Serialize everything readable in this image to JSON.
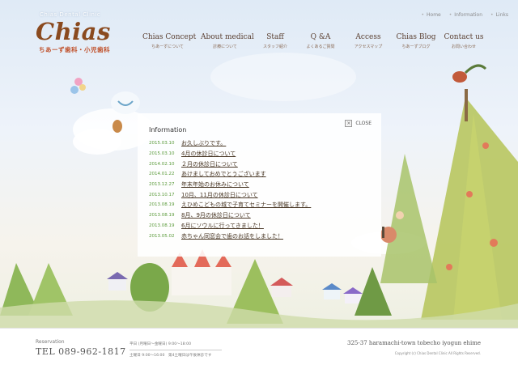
{
  "logo": {
    "small": "Chias Dental Clinic",
    "main": "Chias",
    "sub": "ちあーず歯科・小児歯科"
  },
  "top_links": [
    {
      "label": "Home"
    },
    {
      "label": "Information"
    },
    {
      "label": "Links"
    }
  ],
  "nav": [
    {
      "en": "Chias Concept",
      "jp": "ちあーずについて"
    },
    {
      "en": "About medical",
      "jp": "診療について"
    },
    {
      "en": "Staff",
      "jp": "スタッフ紹介"
    },
    {
      "en": "Q &A",
      "jp": "よくあるご質問"
    },
    {
      "en": "Access",
      "jp": "アクセスマップ"
    },
    {
      "en": "Chias Blog",
      "jp": "ちあーずブログ"
    },
    {
      "en": "Contact us",
      "jp": "お問い合わせ"
    }
  ],
  "info": {
    "title": "Information",
    "close": "CLOSE",
    "items": [
      {
        "date": "2015.03.10",
        "title": "お久しぶりです。"
      },
      {
        "date": "2015.03.10",
        "title": "4月の休診日について"
      },
      {
        "date": "2014.02.10",
        "title": "２月の休診日について"
      },
      {
        "date": "2014.01.22",
        "title": "あけましておめでとうございます"
      },
      {
        "date": "2013.12.27",
        "title": "年末年始のお休みについて"
      },
      {
        "date": "2013.10.17",
        "title": "10月、11月の休診日について"
      },
      {
        "date": "2013.08.19",
        "title": "えひめこどもの城で子育てセミナーを開催します。"
      },
      {
        "date": "2013.08.19",
        "title": "8月、9月の休診日について"
      },
      {
        "date": "2013.08.19",
        "title": "6月にソウルに行ってきました！"
      },
      {
        "date": "2013.05.02",
        "title": "赤ちゃん同窓会で歯のお話をしました！"
      }
    ]
  },
  "footer": {
    "reservation_label": "Reservation",
    "tel": "TEL 089-962-1817",
    "hours_1": "平日 (月曜日～金曜日) 9:00～18:00",
    "hours_2": "土曜日 9:00～16:00　第4土曜日は午後休診です",
    "address": "325-37 haramachi-town tobecho iyogun ehime",
    "copyright": "Copyright (c) Chias Dental Clinic All Rights Reserved."
  },
  "colors": {
    "logo_brown": "#8a4a1f",
    "logo_sub_red": "#c0502a",
    "date_green": "#5a9a3a",
    "link_brown": "#4a3826"
  }
}
